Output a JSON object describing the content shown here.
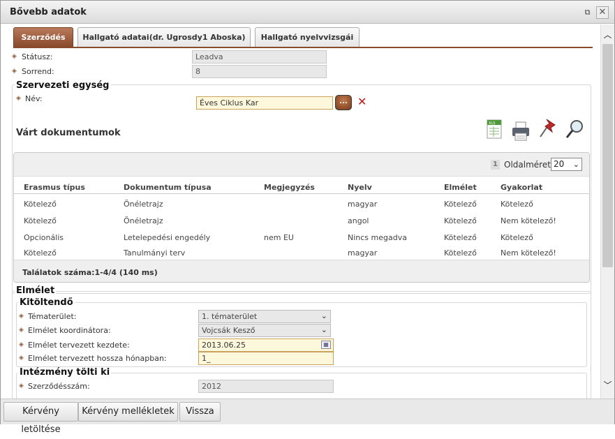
{
  "window": {
    "title": "Bővebb adatok"
  },
  "tabs": [
    {
      "label": "Szerződés"
    },
    {
      "label": "Hallgató adatai(dr. Ugrosdy1 Aboska)"
    },
    {
      "label": "Hallgató nyelvvizsgái"
    }
  ],
  "fields": {
    "status_label": "Státusz:",
    "status_value": "Leadva",
    "order_label": "Sorrend:",
    "order_value": "8"
  },
  "org_unit": {
    "legend": "Szervezeti egység",
    "name_label": "Név:",
    "name_value": "Éves Ciklus Kar",
    "lookup_label": "..."
  },
  "documents": {
    "title": "Várt dokumentumok",
    "toolbar_icons": [
      "excel-export-icon",
      "print-icon",
      "pin-icon",
      "search-icon"
    ],
    "pager": {
      "page": "1",
      "page_size_label": "Oldalméret",
      "page_size": "20"
    },
    "columns": [
      "Erasmus típus",
      "Dokumentum típusa",
      "Megjegyzés",
      "Nyelv",
      "Elmélet",
      "Gyakorlat"
    ],
    "rows": [
      [
        "Kötelező",
        "Önéletrajz",
        "",
        "magyar",
        "Kötelező",
        "Kötelező"
      ],
      [
        "Kötelező",
        "Önéletrajz",
        "",
        "angol",
        "Kötelező",
        "Nem kötelező!"
      ],
      [
        "Opcionális",
        "Letelepedési engedély",
        "nem EU",
        "Nincs megadva",
        "Kötelező",
        "Kötelező"
      ],
      [
        "Kötelező",
        "Tanulmányi terv",
        "",
        "magyar",
        "Kötelező",
        "Nem kötelező!"
      ]
    ],
    "footer": "Találatok száma:1-4/4 (140 ms)"
  },
  "theory": {
    "legend": "Elmélet",
    "to_fill": {
      "legend": "Kitöltendő",
      "topic_label": "Tématerület:",
      "topic_value": "1. tématerület",
      "coordinator_label": "Elmélet koordinátora:",
      "coordinator_value": "Vojcsák Kesző",
      "start_label": "Elmélet tervezett kezdete:",
      "start_value": "2013.06.25",
      "length_label": "Elmélet tervezett hossza hónapban:",
      "length_value": "1_"
    },
    "institution": {
      "legend": "Intézmény tölti ki",
      "contract_no_label": "Szerződésszám:",
      "contract_no_value": "2012"
    }
  },
  "buttons": {
    "download": "Kérvény letöltése",
    "attachments": "Kérvény mellékletek",
    "back": "Vissza"
  },
  "colors": {
    "accent": "#8a4a2c",
    "required_input_bg": "#fdf8dc",
    "close_red": "#c01818"
  }
}
